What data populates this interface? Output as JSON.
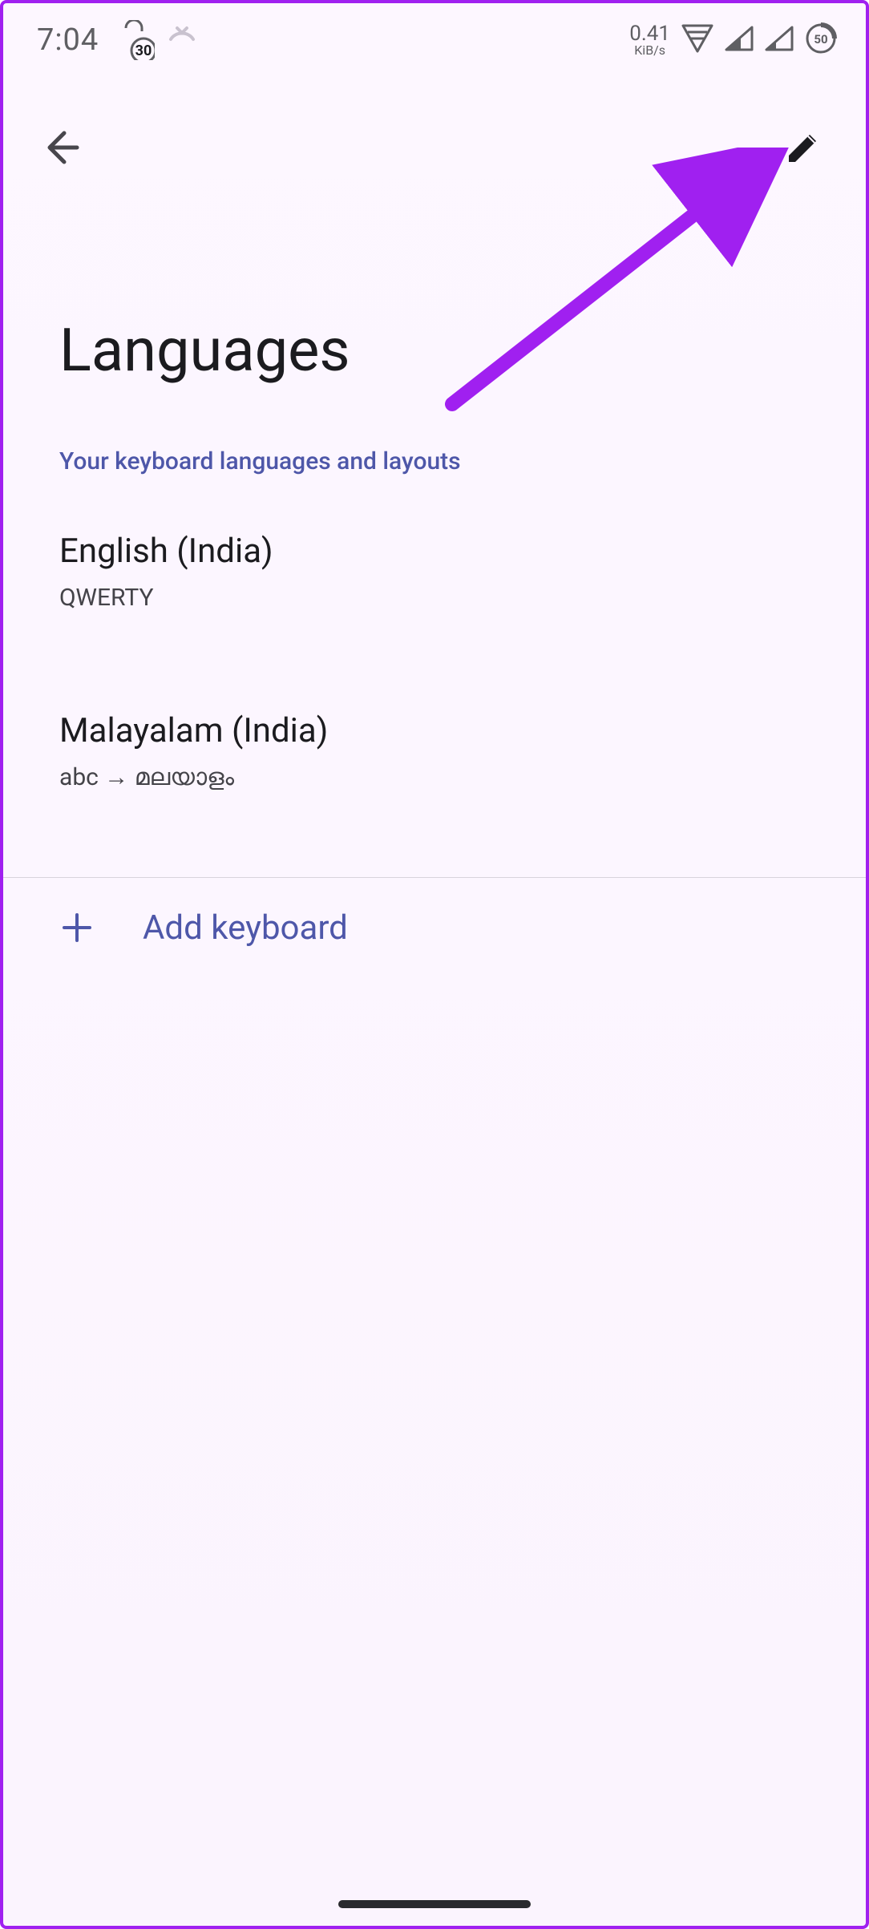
{
  "status_bar": {
    "time": "7:04",
    "lock_badge": "30",
    "net_speed_value": "0.41",
    "net_speed_unit": "KiB/s",
    "battery_pct": "50"
  },
  "app_bar": {
    "back_icon": "arrow-back",
    "edit_icon": "pencil"
  },
  "page": {
    "title": "Languages",
    "section_header": "Your keyboard languages and layouts"
  },
  "languages": [
    {
      "name": "English (India)",
      "layout": "QWERTY"
    },
    {
      "name": "Malayalam (India)",
      "layout": "abc → മലയാളം"
    }
  ],
  "add_keyboard": {
    "label": "Add keyboard"
  },
  "colors": {
    "accent": "#4e57a9",
    "annotation": "#a020f0"
  }
}
